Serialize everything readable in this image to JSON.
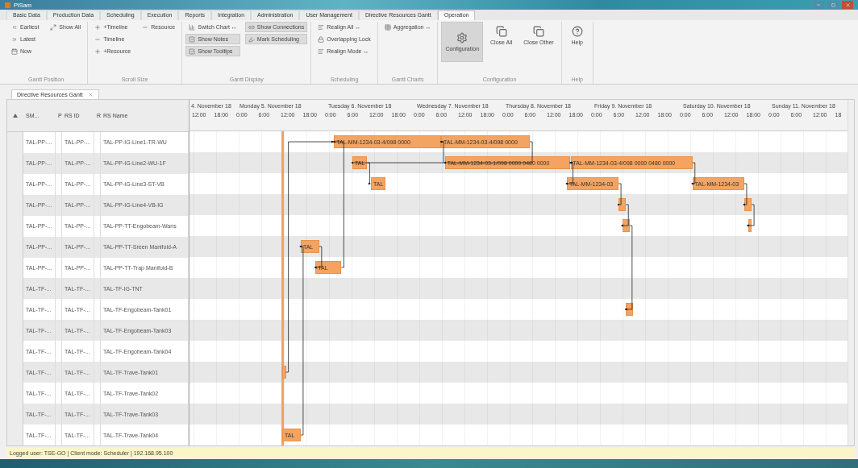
{
  "window": {
    "title": "PiSam"
  },
  "tabs": [
    {
      "label": "Basic Data",
      "selected": false
    },
    {
      "label": "Production Data",
      "selected": false
    },
    {
      "label": "Scheduling",
      "selected": false
    },
    {
      "label": "Execution",
      "selected": false
    },
    {
      "label": "Reports",
      "selected": false
    },
    {
      "label": "Integration",
      "selected": false
    },
    {
      "label": "Administration",
      "selected": false
    },
    {
      "label": "User Management",
      "selected": false
    },
    {
      "label": "Directive Resources Gantt",
      "selected": false
    },
    {
      "label": "Operation",
      "selected": true
    }
  ],
  "ribbon": [
    {
      "label": "Gantt Position",
      "items": [
        {
          "kind": "small",
          "label": "Earliest",
          "on": false
        },
        {
          "kind": "small",
          "label": "Latest",
          "on": false
        },
        {
          "kind": "small",
          "label": "Now",
          "on": false
        },
        {
          "kind": "small",
          "label": "Show All",
          "on": false
        }
      ]
    },
    {
      "label": "Scroll Size",
      "items": [
        {
          "kind": "small",
          "label": "+Timeline",
          "on": false
        },
        {
          "kind": "small",
          "label": "Timeline",
          "on": false
        },
        {
          "kind": "small",
          "label": "+Resource",
          "on": false
        },
        {
          "kind": "small",
          "label": "Resource",
          "on": false
        }
      ]
    },
    {
      "label": "Gantt Display",
      "items": [
        {
          "kind": "small",
          "label": "Switch Chart ↔",
          "on": false
        },
        {
          "kind": "small",
          "label": "Show Notes",
          "on": true
        },
        {
          "kind": "small",
          "label": "Show Tooltips",
          "on": true
        },
        {
          "kind": "small",
          "label": "Show Connections",
          "on": true
        },
        {
          "kind": "small",
          "label": "Mark Scheduling",
          "on": true
        }
      ]
    },
    {
      "label": "Scheduling",
      "items": [
        {
          "kind": "small",
          "label": "Realign All ↔",
          "on": false
        },
        {
          "kind": "small",
          "label": "Overlapping Lock",
          "on": false
        },
        {
          "kind": "small",
          "label": "Realign Mode ↔",
          "on": false
        }
      ]
    },
    {
      "label": "Gantt Charts",
      "items": [
        {
          "kind": "small",
          "label": "Aggregation ↔",
          "on": false
        }
      ]
    },
    {
      "label": "Configuration",
      "items": [
        {
          "kind": "large",
          "label": "Configuration",
          "on": true
        },
        {
          "kind": "large",
          "label": "Close All",
          "on": false
        },
        {
          "kind": "large",
          "label": "Close Other",
          "on": false
        }
      ]
    },
    {
      "label": "Help",
      "items": [
        {
          "kind": "large",
          "label": "Help",
          "on": false
        }
      ]
    }
  ],
  "document_tab": {
    "label": "Directive Resources Gantt"
  },
  "grid": {
    "columns": [
      "SM...",
      "P",
      "RS ID",
      "R",
      "RS Name"
    ],
    "rows": [
      {
        "cells": [
          "TAL-PP-...",
          "",
          "TAL-PP-...",
          "",
          "TAL-PP-IG-Line1-TR-WU"
        ]
      },
      {
        "cells": [
          "TAL-PP-...",
          "",
          "TAL-PP-...",
          "",
          "TAL-PP-IG-Line2-WU-1F"
        ]
      },
      {
        "cells": [
          "TAL-PP-...",
          "",
          "TAL-PP-...",
          "",
          "TAL-PP-IG-Line3-ST-VB"
        ]
      },
      {
        "cells": [
          "TAL-PP-...",
          "",
          "TAL-PP-...",
          "",
          "TAL-PP-IG-Line4-VB-IG"
        ]
      },
      {
        "cells": [
          "TAL-PP-...",
          "",
          "TAL-PP-...",
          "",
          "TAL-PP-TT-Engobeam-Wans"
        ]
      },
      {
        "cells": [
          "TAL-PP-...",
          "",
          "TAL-PP-...",
          "",
          "TAL-PP-TT-Sreen Manifold-A"
        ]
      },
      {
        "cells": [
          "TAL-PP-...",
          "",
          "TAL-PP-...",
          "",
          "TAL-PP-TT-Trap Manifold-B"
        ]
      },
      {
        "cells": [
          "TAL-TF-...",
          "",
          "TAL-TF-...",
          "",
          "TAL-TF-IG-TNT"
        ]
      },
      {
        "cells": [
          "TAL-TF-...",
          "",
          "TAL-TF-...",
          "",
          "TAL-TF-Engobeam-Tank01"
        ]
      },
      {
        "cells": [
          "TAL-TF-...",
          "",
          "TAL-TF-...",
          "",
          "TAL-TF-Engobeam-Tank03"
        ]
      },
      {
        "cells": [
          "TAL-TF-...",
          "",
          "TAL-TF-...",
          "",
          "TAL-TF-Engobeam-Tank04"
        ]
      },
      {
        "cells": [
          "TAL-TF-...",
          "",
          "TAL-TF-...",
          "",
          "TAL-TF-Trave-Tank01"
        ]
      },
      {
        "cells": [
          "TAL-TF-...",
          "",
          "TAL-TF-...",
          "",
          "TAL-TF-Trave-Tank02"
        ]
      },
      {
        "cells": [
          "TAL-TF-...",
          "",
          "TAL-TF-...",
          "",
          "TAL-TF-Trave-Tank03"
        ]
      },
      {
        "cells": [
          "TAL-TF-...",
          "",
          "TAL-TF-...",
          "",
          "TAL-TF-Trave-Tank04"
        ]
      }
    ]
  },
  "gantt": {
    "days": [
      {
        "label": "4. November 18",
        "ticks": [
          "12:00",
          "18:00"
        ]
      },
      {
        "label": "Monday 5. November 18",
        "ticks": [
          "0:00",
          "6:00",
          "12:00",
          "18:00"
        ]
      },
      {
        "label": "Tuesday 6. November 18",
        "ticks": [
          "0:00",
          "6:00",
          "12:00",
          "18:00"
        ]
      },
      {
        "label": "Wednesday 7. November 18",
        "ticks": [
          "0:00",
          "6:00",
          "12:00",
          "18:00"
        ]
      },
      {
        "label": "Thursday 8. November 18",
        "ticks": [
          "0:00",
          "6:00",
          "12:00",
          "18:00"
        ]
      },
      {
        "label": "Friday 9. November 18",
        "ticks": [
          "0:00",
          "6:00",
          "12:00",
          "18:00"
        ]
      },
      {
        "label": "Saturday 10. November 18",
        "ticks": [
          "0:00",
          "6:00",
          "12:00",
          "18:00"
        ]
      },
      {
        "label": "Sunday 11. November 18",
        "ticks": [
          "0:00",
          "6:00",
          "12:00",
          "18"
        ]
      }
    ],
    "rows": [
      {
        "bars": [
          {
            "kind": "task",
            "label": "TAL-MM-1234-03-4/098 0000"
          },
          {
            "kind": "task",
            "label": "TAL-MM-1234-03-4/098 0000"
          }
        ]
      },
      {
        "bars": [
          {
            "kind": "task",
            "label": "TAL"
          },
          {
            "kind": "task",
            "label": "TAL-MM-1234-03-1/098 0000 0480 0000"
          },
          {
            "kind": "task",
            "label": "TAL-MM-1234-03-4/098 0000 0480 0000"
          }
        ]
      },
      {
        "bars": [
          {
            "kind": "task",
            "label": "TAL"
          },
          {
            "kind": "task",
            "label": "TAL-MM-1234-03"
          },
          {
            "kind": "task",
            "label": "TAL-MM-1234-03"
          }
        ]
      },
      {
        "bars": [
          {
            "kind": "task"
          },
          {
            "kind": "task"
          }
        ]
      },
      {
        "bars": [
          {
            "kind": "task"
          },
          {
            "kind": "task"
          }
        ]
      },
      {
        "bars": [
          {
            "kind": "task",
            "label": "TAL"
          }
        ]
      },
      {
        "bars": [
          {
            "kind": "task",
            "label": "TAL"
          }
        ]
      },
      {
        "bars": []
      },
      {
        "bars": [
          {
            "kind": "task"
          }
        ]
      },
      {
        "bars": []
      },
      {
        "bars": []
      },
      {
        "bars": [
          {
            "kind": "task"
          }
        ]
      },
      {
        "bars": []
      },
      {
        "bars": []
      },
      {
        "bars": [
          {
            "kind": "task",
            "label": "TAL"
          }
        ]
      }
    ]
  },
  "status_bar": "Logged user: TSE-GO | Client mode: Scheduler | 192.168.95.100"
}
